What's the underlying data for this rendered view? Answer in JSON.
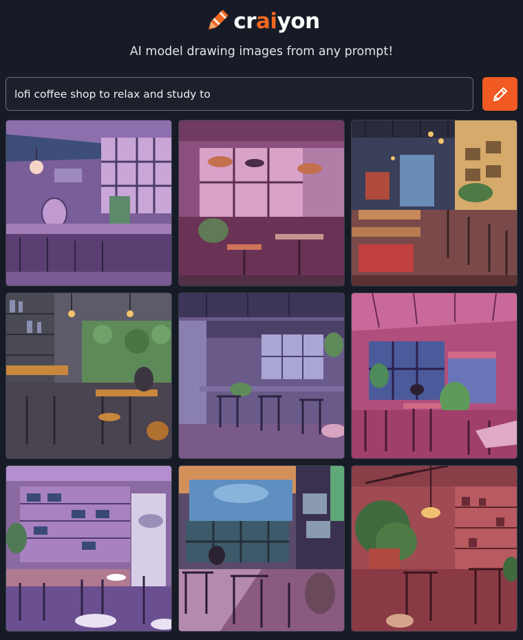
{
  "brand": {
    "name_pre": "cr",
    "name_accent": "ai",
    "name_post": "yon",
    "icon": "crayon-icon",
    "accent_color": "#f26722"
  },
  "tagline": "AI model drawing images from any prompt!",
  "prompt": {
    "value": "lofi coffee shop to relax and study to",
    "placeholder": ""
  },
  "draw_button": {
    "icon": "pencil-icon",
    "color": "#f15a22"
  },
  "results": {
    "count": 9,
    "prompt": "lofi coffee shop to relax and study to"
  }
}
